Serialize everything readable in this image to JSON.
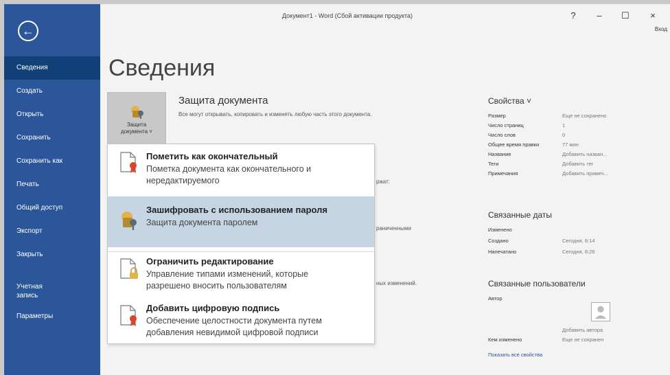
{
  "window": {
    "title": "Документ1 - Word (Сбой активации продукта)",
    "help": "?",
    "minimize": "–",
    "maximize": "☐",
    "close": "×",
    "signin": "Вход"
  },
  "sidebar": {
    "back": "←",
    "items": [
      {
        "label": "Сведения",
        "active": true
      },
      {
        "label": "Создать"
      },
      {
        "label": "Открыть"
      },
      {
        "label": "Сохранить"
      },
      {
        "label": "Сохранить как"
      },
      {
        "label": "Печать"
      },
      {
        "label": "Общий доступ"
      },
      {
        "label": "Экспорт"
      },
      {
        "label": "Закрыть"
      },
      {
        "label": "Учетная\nзапись"
      },
      {
        "label": "Параметры"
      }
    ]
  },
  "main": {
    "title": "Сведения",
    "protect": {
      "tile_label_1": "Защита",
      "tile_label_2": "документа ˅",
      "title": "Защита документа",
      "desc": "Все могут открывать, копировать и изменять любую часть этого документа."
    },
    "trunc_texts": [
      "ржат:",
      "раниченными",
      "ных изменений."
    ]
  },
  "menu": {
    "items": [
      {
        "title": "Пометить как окончательный",
        "desc": [
          "Пометка документа как окончательного и",
          "нередактируемого"
        ]
      },
      {
        "title": "Зашифровать с использованием пароля",
        "desc": [
          "Защита документа паролем"
        ]
      },
      {
        "title": "Ограничить редактирование",
        "desc": [
          "Управление типами изменений, которые",
          "разрешено вносить пользователям"
        ]
      },
      {
        "title": "Добавить цифровую подпись",
        "desc": [
          "Обеспечение целостности документа путем",
          "добавления невидимой цифровой подписи"
        ]
      }
    ]
  },
  "properties": {
    "title": "Свойства ˅",
    "rows": [
      {
        "k": "Размер",
        "v": "Еще не сохранено"
      },
      {
        "k": "Число страниц",
        "v": "1"
      },
      {
        "k": "Число слов",
        "v": "0"
      },
      {
        "k": "Общее время правки",
        "v": "77 мин"
      },
      {
        "k": "Название",
        "v": "Добавить назван..."
      },
      {
        "k": "Теги",
        "v": "Добавить тег"
      },
      {
        "k": "Примечания",
        "v": "Добавить примеч..."
      }
    ],
    "dates_title": "Связанные даты",
    "dates": [
      {
        "k": "Изменено",
        "v": ""
      },
      {
        "k": "Создано",
        "v": "Сегодня, 8:14"
      },
      {
        "k": "Напечатано",
        "v": "Сегодня, 8:26"
      }
    ],
    "people_title": "Связанные пользователи",
    "author_label": "Автор",
    "add_author": "Добавить автора",
    "modified_by_label": "Кем изменено",
    "modified_by_value": "Еще не сохранен",
    "show_all": "Показать все свойства"
  },
  "colors": {
    "sidebar": "#2b579a",
    "sidebar_active": "#124078",
    "highlight": "#c5d5e3",
    "background": "#f3f3f3"
  }
}
